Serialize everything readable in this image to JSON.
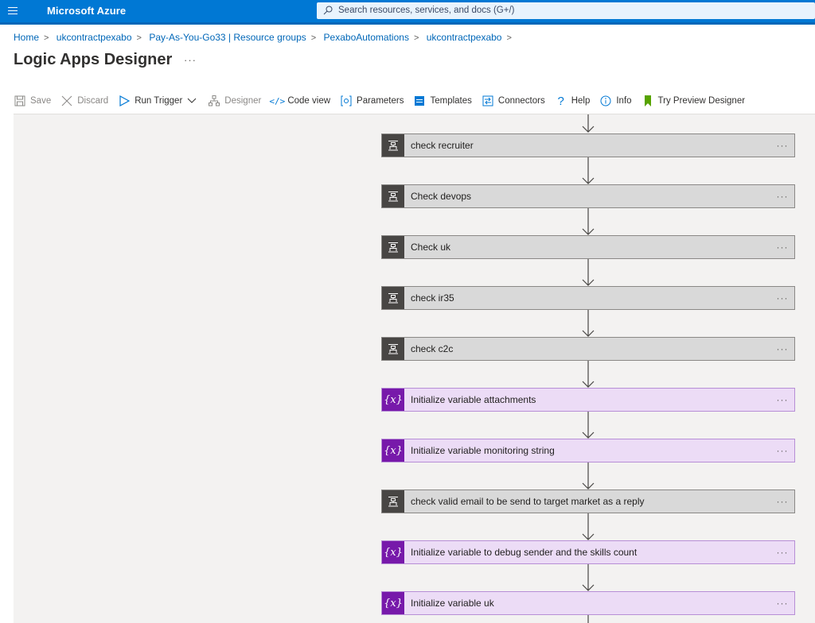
{
  "header": {
    "brand": "Microsoft Azure",
    "search_placeholder": "Search resources, services, and docs (G+/)",
    "accent": "#0078d4"
  },
  "breadcrumb": [
    "Home",
    "ukcontractpexabo",
    "Pay-As-You-Go33 | Resource groups",
    "PexaboAutomations",
    "ukcontractpexabo"
  ],
  "page": {
    "title": "Logic Apps Designer",
    "more": "···"
  },
  "toolbar": {
    "save": "Save",
    "discard": "Discard",
    "run_trigger": "Run Trigger",
    "designer": "Designer",
    "code_view": "Code view",
    "parameters": "Parameters",
    "templates": "Templates",
    "connectors": "Connectors",
    "help": "Help",
    "info": "Info",
    "try_preview": "Try Preview Designer"
  },
  "steps": [
    {
      "label": "check recruiter",
      "kind": "condition"
    },
    {
      "label": "Check devops",
      "kind": "condition"
    },
    {
      "label": "Check uk",
      "kind": "condition"
    },
    {
      "label": "check ir35",
      "kind": "condition"
    },
    {
      "label": "check c2c",
      "kind": "condition"
    },
    {
      "label": "Initialize variable attachments",
      "kind": "variable"
    },
    {
      "label": "Initialize variable monitoring string",
      "kind": "variable"
    },
    {
      "label": "check valid email to be send to target market as a reply",
      "kind": "condition"
    },
    {
      "label": "Initialize variable to debug sender and the skills count",
      "kind": "variable"
    },
    {
      "label": "Initialize variable uk",
      "kind": "variable"
    }
  ],
  "step_more": "···",
  "variable_icon": "{x}",
  "colors": {
    "condition_icon_bg": "#484644",
    "variable_icon_bg": "#7719aa",
    "variable_bg": "#ecdcf6",
    "condition_bg": "#d9d9d9"
  }
}
